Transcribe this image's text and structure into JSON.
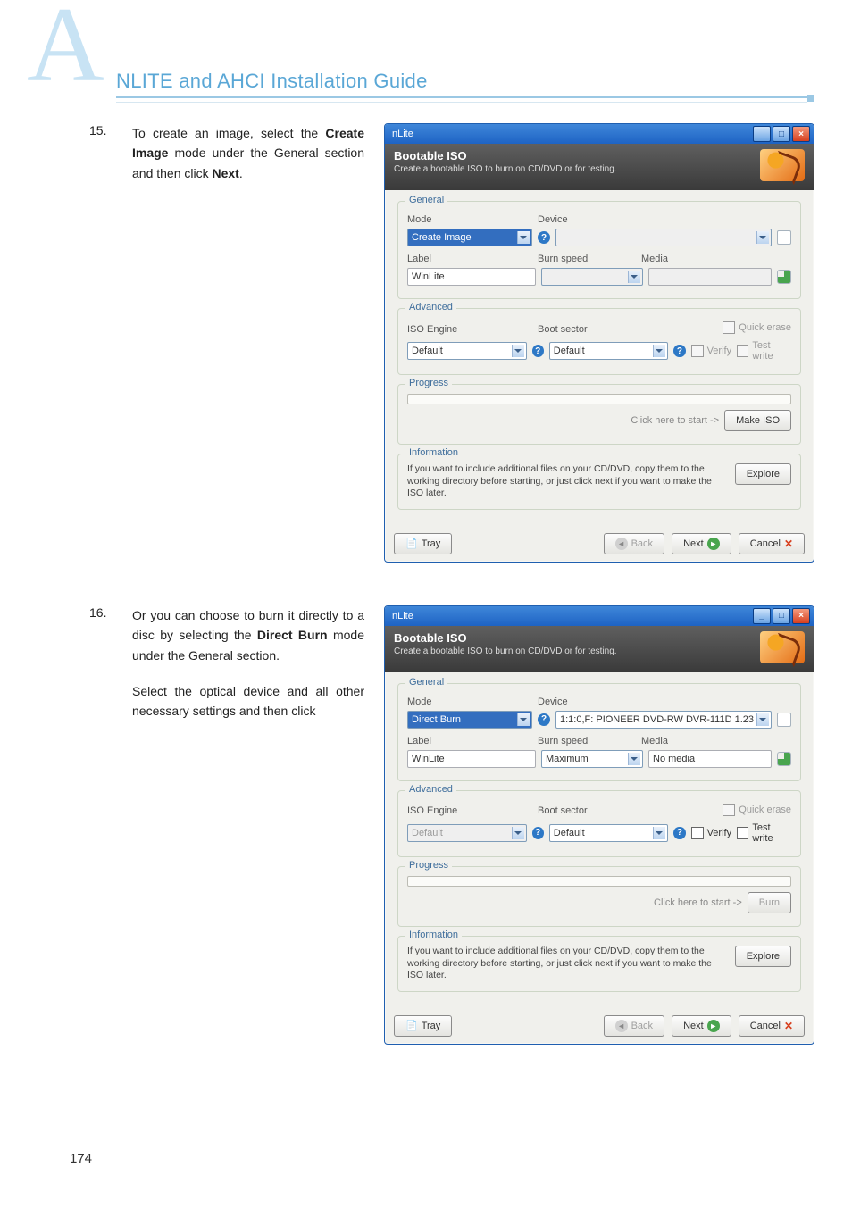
{
  "header": {
    "big_letter": "A",
    "title": "NLITE and AHCI Installation Guide"
  },
  "step15": {
    "num": "15.",
    "text_pre": "To create an image, select the ",
    "kw1": "Create Image",
    "text_mid": " mode under the General section and then click ",
    "kw2": "Next",
    "text_post": "."
  },
  "step16": {
    "num": "16.",
    "p1_pre": "Or you can choose to burn it directly to a disc by selecting the ",
    "kw1": "Direct Burn",
    "p1_post": " mode under the General section.",
    "p2": "Select the optical device and all other necessary settings and then click"
  },
  "dlgCommon": {
    "title": "nLite",
    "banner_title": "Bootable ISO",
    "banner_sub": "Create a bootable ISO to burn on CD/DVD or for testing.",
    "grp_general": "General",
    "grp_advanced": "Advanced",
    "grp_progress": "Progress",
    "lbl_mode": "Mode",
    "lbl_device": "Device",
    "lbl_label": "Label",
    "lbl_burnspeed": "Burn speed",
    "lbl_media": "Media",
    "lbl_iso_engine": "ISO Engine",
    "lbl_boot_sector": "Boot sector",
    "chk_quickerase": "Quick erase",
    "chk_verify": "Verify",
    "chk_testwrite": "Test write",
    "start_hint": "Click here to start ->",
    "info_title": "Information",
    "info_text": "If you want to include additional files on your CD/DVD, copy them to the working directory before starting, or just click next if you want to make the ISO later.",
    "btn_explore": "Explore",
    "btn_tray": "Tray",
    "btn_back": "Back",
    "btn_next": "Next",
    "btn_cancel": "Cancel",
    "val_default": "Default",
    "val_label": "WinLite"
  },
  "dlg1": {
    "mode": "Create Image",
    "burnspeed": "",
    "media": "",
    "device": "",
    "btn_make_iso": "Make ISO"
  },
  "dlg2": {
    "mode": "Direct Burn",
    "device": "1:1:0,F: PIONEER  DVD-RW  DVR-111D 1.23",
    "burnspeed": "Maximum",
    "media": "No media",
    "btn_burn": "Burn"
  },
  "pagefoot": "174"
}
